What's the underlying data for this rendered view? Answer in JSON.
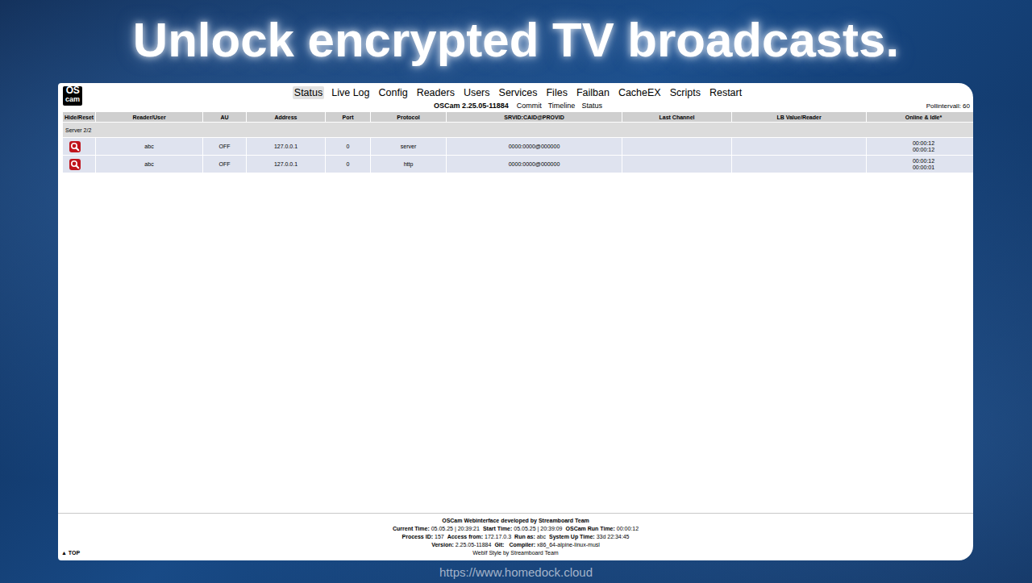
{
  "headline": "Unlock encrypted TV broadcasts.",
  "logo": {
    "top": "OS",
    "bottom": "cam"
  },
  "nav": [
    {
      "label": "Status",
      "selected": true
    },
    {
      "label": "Live Log",
      "selected": false
    },
    {
      "label": "Config",
      "selected": false
    },
    {
      "label": "Readers",
      "selected": false
    },
    {
      "label": "Users",
      "selected": false
    },
    {
      "label": "Services",
      "selected": false
    },
    {
      "label": "Files",
      "selected": false
    },
    {
      "label": "Failban",
      "selected": false
    },
    {
      "label": "CacheEX",
      "selected": false
    },
    {
      "label": "Scripts",
      "selected": false
    },
    {
      "label": "Restart",
      "selected": false
    }
  ],
  "subheader": {
    "title": "OSCam 2.25.05-11884",
    "links": [
      "Commit",
      "Timeline",
      "Status"
    ],
    "poll": "Pollintervall: 60"
  },
  "table": {
    "columns": [
      "Hide/Reset",
      "Reader/User",
      "AU",
      "Address",
      "Port",
      "Protocol",
      "SRVID:CAID@PROVID",
      "Last Channel",
      "LB Value/Reader",
      "Online & Idle*"
    ],
    "group": "Server 2/2",
    "rows": [
      {
        "user": "abc",
        "au": "OFF",
        "address": "127.0.0.1",
        "port": "0",
        "protocol": "server",
        "srvid": "0000:0000@000000",
        "last_channel": "",
        "lb": "",
        "online": "00:00:12",
        "idle": "00:00:12"
      },
      {
        "user": "abc",
        "au": "OFF",
        "address": "127.0.0.1",
        "port": "0",
        "protocol": "http",
        "srvid": "0000:0000@000000",
        "last_channel": "",
        "lb": "",
        "online": "00:00:12",
        "idle": "00:00:01"
      }
    ]
  },
  "footer": {
    "credit": "OSCam Webinterface developed by Streamboard Team",
    "lines": [
      [
        {
          "label": "Current Time:",
          "value": "05.05.25 | 20:39:21"
        },
        {
          "label": "Start Time:",
          "value": "05.05.25 | 20:39:09"
        },
        {
          "label": "OSCam Run Time:",
          "value": "00:00:12"
        }
      ],
      [
        {
          "label": "Process ID:",
          "value": "157"
        },
        {
          "label": "Access from:",
          "value": "172.17.0.3"
        },
        {
          "label": "Run as:",
          "value": "abc"
        },
        {
          "label": "System Up Time:",
          "value": "33d 22:34:45"
        }
      ],
      [
        {
          "label": "Version:",
          "value": "2.25.05-11884"
        },
        {
          "label": "Git:",
          "value": ""
        },
        {
          "label": "Compiler:",
          "value": "x86_64-alpine-linux-musl"
        }
      ]
    ],
    "style": "WebIf Style by Streamboard Team",
    "top_link": "▲ TOP"
  },
  "watermark": "https://www.homedock.cloud"
}
